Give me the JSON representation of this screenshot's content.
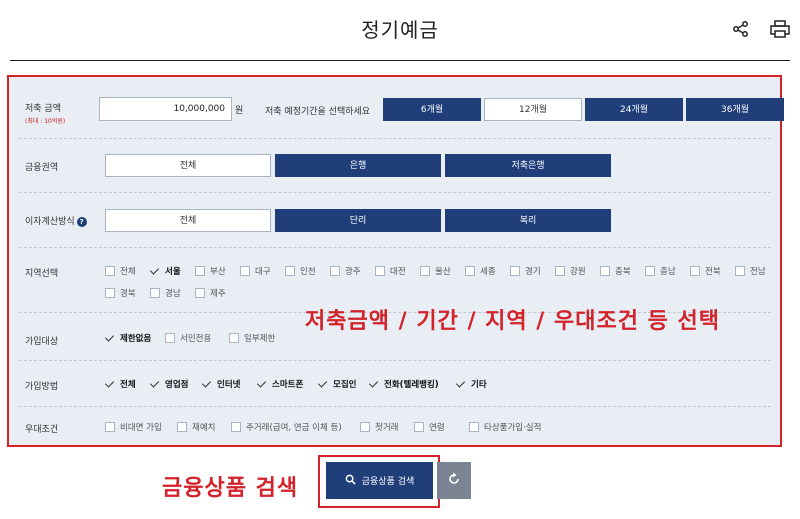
{
  "header": {
    "title": "정기예금",
    "share_icon": "share-icon",
    "print_icon": "print-icon"
  },
  "amount": {
    "label": "저축 금액",
    "sub": "(최대 : 10억원)",
    "value": "10,000,000",
    "unit": "원"
  },
  "period": {
    "label": "저축 예정기간을 선택하세요",
    "options": [
      "6개월",
      "12개월",
      "24개월",
      "36개월"
    ],
    "selected": [
      "6개월",
      "24개월",
      "36개월"
    ]
  },
  "sector": {
    "label": "금융권역",
    "options": [
      "전체",
      "은행",
      "저축은행"
    ]
  },
  "interest": {
    "label": "이자계산방식",
    "options": [
      "전체",
      "단리",
      "복리"
    ]
  },
  "region": {
    "label": "지역선택",
    "row1": [
      "전체",
      "서울",
      "부산",
      "대구",
      "인천",
      "광주",
      "대전",
      "울산",
      "세종",
      "경기",
      "강원",
      "충북",
      "충남",
      "전북",
      "전남"
    ],
    "row2": [
      "경북",
      "경남",
      "제주"
    ],
    "checked": [
      "서울"
    ]
  },
  "target": {
    "label": "가입대상",
    "options": [
      "제한없음",
      "서민전용",
      "일부제한"
    ],
    "checked": [
      "제한없음"
    ]
  },
  "method": {
    "label": "가입방법",
    "options": [
      "전체",
      "영업점",
      "인터넷",
      "스마트폰",
      "모집인",
      "전화(텔레뱅킹)",
      "기타"
    ],
    "checked": [
      "전체",
      "영업점",
      "인터넷",
      "스마트폰",
      "모집인",
      "전화(텔레뱅킹)",
      "기타"
    ]
  },
  "perks": {
    "label": "우대조건",
    "options": [
      "비대면 가입",
      "재예치",
      "주거래(급여, 연금 이체 등)",
      "첫거래",
      "연령",
      "타상품가입·실적"
    ]
  },
  "annotation": {
    "filters": "저축금액 / 기간 / 지역 / 우대조건 등 선택",
    "search": "금융상품 검색"
  },
  "search": {
    "label": "금융상품 검색",
    "icon": "search-icon",
    "reset_icon": "reset-icon"
  },
  "colors": {
    "navy": "#1f3e7a",
    "red": "#d3222a",
    "panel": "#e9edf4"
  }
}
